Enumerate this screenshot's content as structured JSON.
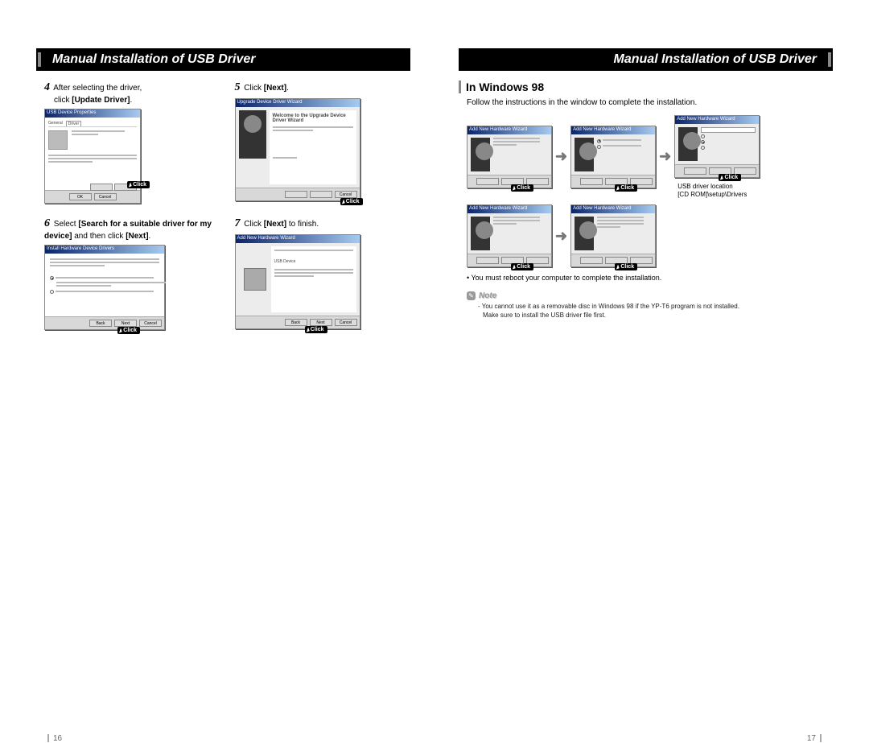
{
  "leftPage": {
    "headerTitle": "Manual Installation of USB Driver",
    "pageNumber": "16",
    "step4": {
      "num": "4",
      "text_a": "After selecting the driver,",
      "text_b": "click ",
      "bold": "[Update Driver]",
      "tail": ".",
      "winTitle": "USB Device Properties",
      "clickLabel": "Click"
    },
    "step5": {
      "num": "5",
      "text_a": "Click ",
      "bold": "[Next]",
      "tail": ".",
      "winTitle": "Upgrade Device Driver Wizard",
      "wizTitle": "Welcome to the Upgrade Device Driver Wizard",
      "clickLabel": "Click"
    },
    "step6": {
      "num": "6",
      "text_a": "Select  ",
      "bold1": "[Search for a suitable driver for my device]",
      "text_b": " and then click ",
      "bold2": "[Next]",
      "tail": ".",
      "winTitle": "Install Hardware Device Drivers",
      "clickLabel": "Click"
    },
    "step7": {
      "num": "7",
      "text_a": "Click ",
      "bold": "[Next]",
      "tail": " to finish.",
      "winTitle": "Add New Hardware Wizard",
      "clickLabel": "Click"
    }
  },
  "rightPage": {
    "headerTitle": "Manual Installation of USB Driver",
    "pageNumber": "17",
    "sectionTitle": "In Windows 98",
    "instruction": "Follow the instructions in the window to complete the installation.",
    "clickLabel": "Click",
    "usbLoc1": "USB driver location",
    "usbLoc2": "[CD ROM]\\setup\\Drivers",
    "rebootText": "You must reboot your computer to complete the installation.",
    "noteLabel": "Note",
    "noteLine1": "You cannot use it as a removable disc in Windows 98 if the YP-T6 program is not installed.",
    "noteLine2": "Make sure to install the USB driver file first."
  }
}
